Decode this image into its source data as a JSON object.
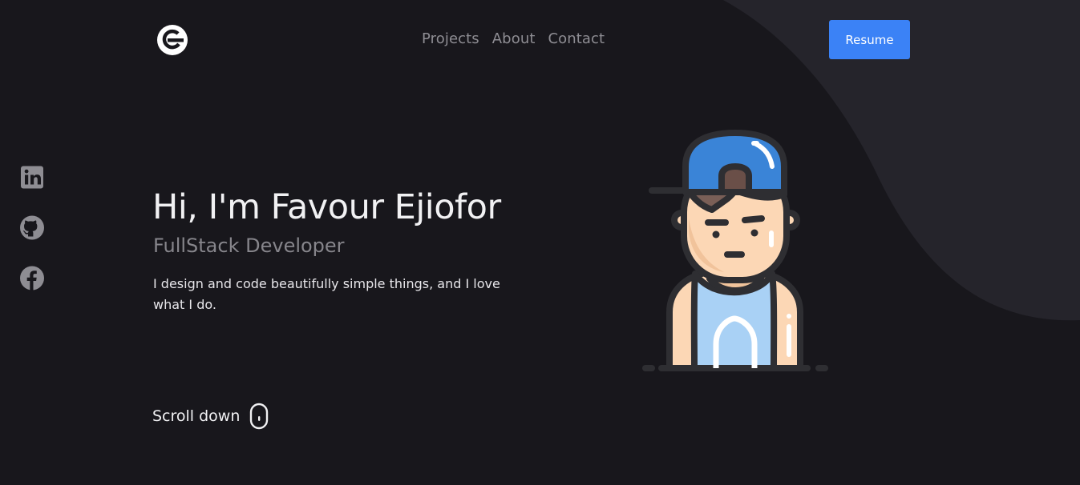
{
  "nav": {
    "logo_icon": "g-logo-icon",
    "links": [
      "Projects",
      "About",
      "Contact"
    ],
    "resume_label": "Resume"
  },
  "socials": [
    {
      "icon": "linkedin-icon"
    },
    {
      "icon": "github-icon"
    },
    {
      "icon": "facebook-icon"
    }
  ],
  "hero": {
    "title": "Hi, I'm Favour Ejiofor",
    "subtitle": "FullStack Developer",
    "description": "I design and code beautifully simple things, and I love what I do."
  },
  "scroll": {
    "label": "Scroll down",
    "icon": "mouse-icon"
  },
  "colors": {
    "background": "#18171c",
    "wave": "#25242b",
    "accent": "#3b82f6",
    "muted_text": "#8e8d93"
  }
}
